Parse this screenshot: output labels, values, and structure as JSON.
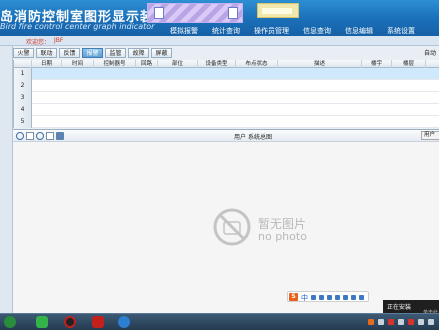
{
  "header": {
    "title": "岛消防控制室图形显示装置",
    "subtitle": "Bird fire control center graph indicator",
    "nav": [
      "模拟报警",
      "统计查询",
      "操作员管理",
      "信息查询",
      "信息编辑",
      "系统设置"
    ]
  },
  "infobar": {
    "welcome": "欢迎您：",
    "user": "JBF"
  },
  "tabs": [
    "火警",
    "联动",
    "反馈",
    "报警",
    "监管",
    "故障",
    "屏蔽"
  ],
  "active_tab": "报警",
  "auto_label": "自动",
  "grid": {
    "columns": [
      "日期",
      "时间",
      "控制器号",
      "回路",
      "部位",
      "设备类型",
      "布点状态",
      "描述",
      "楼宇",
      "楼层"
    ],
    "row_numbers": [
      "1",
      "2",
      "3",
      "4",
      "5"
    ]
  },
  "lower": {
    "title": "用户 系统总图",
    "right_button": "用户"
  },
  "placeholder": {
    "cn": "暂无图片",
    "en": "no photo"
  },
  "ime": {
    "lang": "中"
  },
  "notification": {
    "line1": "正在安装",
    "line2": "单击此"
  },
  "colors": {
    "header": "#1a6fb8",
    "active_tab": "#5e9fd3",
    "selected_row": "#cfe8fb"
  }
}
